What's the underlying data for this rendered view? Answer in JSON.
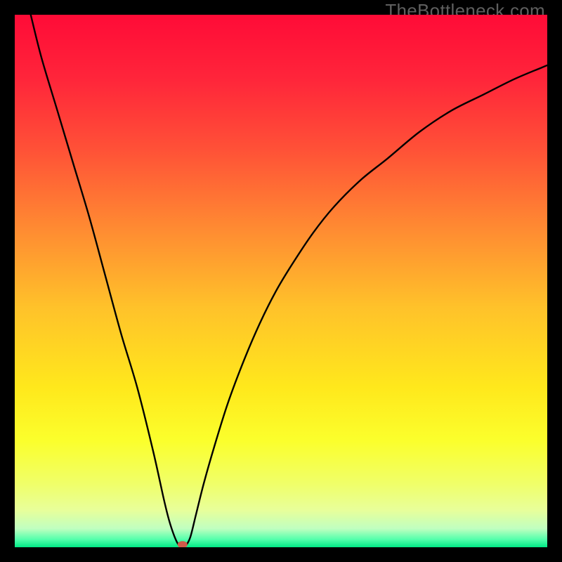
{
  "watermark": "TheBottleneck.com",
  "chart_data": {
    "type": "line",
    "title": "",
    "xlabel": "",
    "ylabel": "",
    "xlim": [
      0,
      100
    ],
    "ylim": [
      0,
      100
    ],
    "x": [
      3,
      5,
      8,
      11,
      14,
      17,
      20,
      23,
      26,
      28,
      29,
      30,
      30.8,
      31.5,
      32.2,
      33,
      34,
      35.5,
      37.5,
      40,
      43,
      46,
      49,
      52,
      56,
      60,
      65,
      70,
      76,
      82,
      88,
      94,
      100
    ],
    "y": [
      100,
      92,
      82,
      72,
      62,
      51,
      40,
      30,
      18,
      9,
      5,
      2,
      0.4,
      0.1,
      0.4,
      2,
      6,
      12,
      19,
      27,
      35,
      42,
      48,
      53,
      59,
      64,
      69,
      73,
      78,
      82,
      85,
      88,
      90.5
    ],
    "marker": {
      "x": 31.5,
      "y": 0.5
    },
    "background_gradient": {
      "stops": [
        {
          "offset": 0.0,
          "color": "#ff0b37"
        },
        {
          "offset": 0.12,
          "color": "#ff253a"
        },
        {
          "offset": 0.25,
          "color": "#ff5037"
        },
        {
          "offset": 0.4,
          "color": "#ff8a32"
        },
        {
          "offset": 0.55,
          "color": "#ffc22a"
        },
        {
          "offset": 0.7,
          "color": "#ffe81c"
        },
        {
          "offset": 0.8,
          "color": "#fbff2c"
        },
        {
          "offset": 0.88,
          "color": "#f0ff68"
        },
        {
          "offset": 0.93,
          "color": "#e8ff9a"
        },
        {
          "offset": 0.965,
          "color": "#c0ffc0"
        },
        {
          "offset": 0.985,
          "color": "#55ffac"
        },
        {
          "offset": 1.0,
          "color": "#00e985"
        }
      ]
    }
  }
}
